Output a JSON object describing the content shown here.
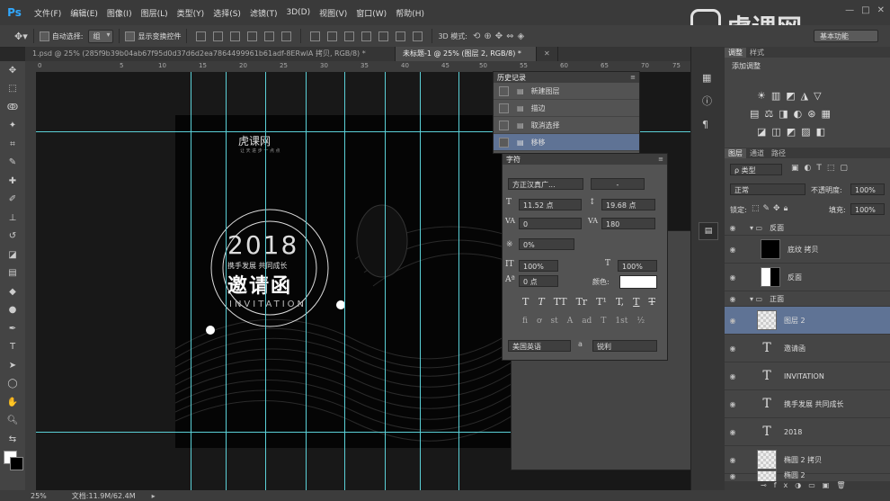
{
  "menu": [
    "文件(F)",
    "编辑(E)",
    "图像(I)",
    "图层(L)",
    "类型(Y)",
    "选择(S)",
    "滤镜(T)",
    "3D(D)",
    "视图(V)",
    "窗口(W)",
    "帮助(H)"
  ],
  "app_logo": "Ps",
  "options": {
    "auto_select_label": "自动选择:",
    "auto_select_value": "组",
    "show_transform_label": "显示变换控件",
    "mode_3d_label": "3D 模式:"
  },
  "workspace": "基本功能",
  "watermark": "虎课网",
  "tabs": [
    {
      "label": "1.psd @ 25% (285f9b39b04ab67f95d0d37d6d2ea7864499961b61adf-8ERwIA 拷贝, RGB/8) *",
      "active": false
    },
    {
      "label": "未标题-1 @ 25% (图层 2, RGB/8) *",
      "active": true
    }
  ],
  "ruler_marks": [
    "0",
    "5",
    "10",
    "15",
    "20",
    "25",
    "30",
    "35",
    "40",
    "45",
    "50",
    "55",
    "60",
    "65",
    "70",
    "75"
  ],
  "canvas": {
    "logo": "虎课网",
    "logo_sub": "让 天 进 步 一 点 点",
    "year": "2018",
    "slogan": "携手发展 共同成长",
    "title": "邀请函",
    "subtitle": "INVITATION"
  },
  "history": {
    "title": "历史记录",
    "items": [
      "新建图层",
      "描边",
      "取消选择",
      "移移"
    ]
  },
  "character": {
    "title": "字符",
    "font_family": "方正汉真广...",
    "font_style": "-",
    "font_size": "11.52 点",
    "leading": "19.68 点",
    "kerning": "0",
    "tracking": "180",
    "vertical_scale_label": "0%",
    "scale_v": "100%",
    "scale_h": "100%",
    "baseline": "0 点",
    "color_label": "颜色:",
    "language": "美国英语",
    "aa_label": "a",
    "antialias": "锐利",
    "style_buttons": [
      "T",
      "T",
      "TT",
      "Tr",
      "T¹",
      "T,",
      "T",
      "T"
    ],
    "ot_buttons": [
      "fi",
      "ơ",
      "st",
      "A",
      "ad",
      "T",
      "1st",
      "½"
    ]
  },
  "adjust": {
    "tabs": [
      "调整",
      "样式"
    ],
    "add_label": "添加调整"
  },
  "layers": {
    "tabs": [
      "图层",
      "通道",
      "路径"
    ],
    "filter_label": "ρ 类型",
    "blend_mode": "正常",
    "opacity_label": "不透明度:",
    "opacity": "100%",
    "lock_label": "锁定:",
    "fill_label": "填充:",
    "fill": "100%",
    "items": [
      {
        "name": "反面",
        "type": "group"
      },
      {
        "name": "底纹 拷贝",
        "type": "thumb-black"
      },
      {
        "name": "反面",
        "type": "thumb-half"
      },
      {
        "name": "正面",
        "type": "group"
      },
      {
        "name": "图层 2",
        "type": "thumb-checker",
        "selected": true
      },
      {
        "name": "邀请函",
        "type": "text"
      },
      {
        "name": "INVITATION",
        "type": "text"
      },
      {
        "name": "携手发展 共同成长",
        "type": "text"
      },
      {
        "name": "2018",
        "type": "text"
      },
      {
        "name": "椭圆 2 拷贝",
        "type": "thumb-checker"
      },
      {
        "name": "椭圆 2",
        "type": "thumb-checker"
      }
    ]
  },
  "status": {
    "zoom": "25%",
    "doc_info": "文档:11.9M/62.4M"
  },
  "colors": {
    "guide": "#5bd0d7",
    "selection": "#5f7395"
  }
}
